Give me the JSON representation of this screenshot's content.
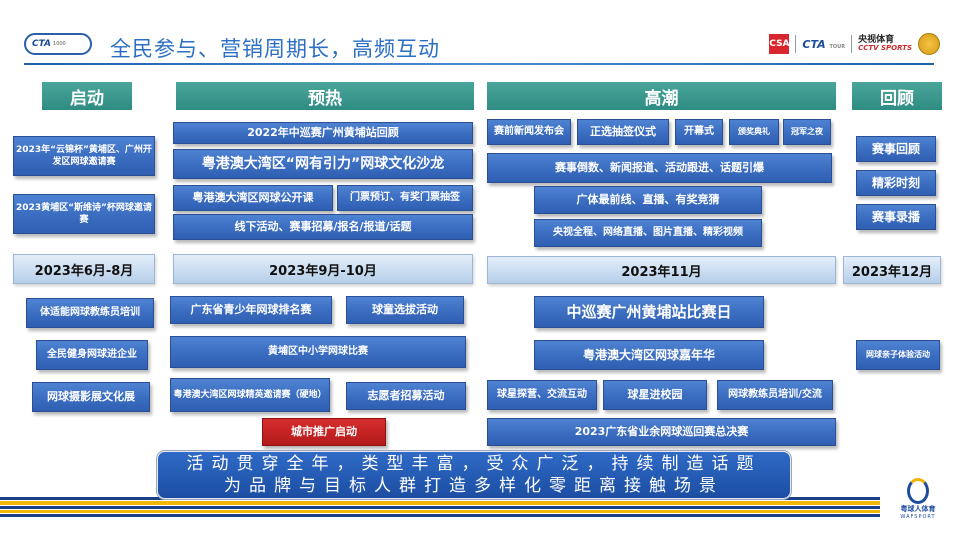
{
  "header": {
    "logo_left": "CTA",
    "logo_left_sub": "1000",
    "title": "全民参与、营销周期长，高频互动",
    "brand_csa": "CSA",
    "brand_cta": "CTA",
    "brand_cta_sub": "TOUR",
    "brand_cctv_cn": "央视体育",
    "brand_cctv_en": "CCTV SPORTS"
  },
  "phases": {
    "start": "启动",
    "warmup": "预热",
    "climax": "高潮",
    "review": "回顾"
  },
  "start": {
    "item1": "2023年“云锦杯”黄埔区、广州开发区网球邀请赛",
    "item2": "2023黄埔区“斯维诗”杯网球邀请赛",
    "date": "2023年6月-8月",
    "item3": "体适能网球教练员培训",
    "item4": "全民健身网球进企业",
    "item5": "网球摄影展文化展"
  },
  "warmup": {
    "item1": "2022年中巡赛广州黄埔站回顾",
    "item2": "粤港澳大湾区“网有引力”网球文化沙龙",
    "item3": "粤港澳大湾区网球公开课",
    "item4": "门票预订、有奖门票抽签",
    "item5": "线下活动、赛事招募/报名/报道/话题",
    "date": "2023年9月-10月",
    "item6": "广东省青少年网球排名赛",
    "item7": "球童选拔活动",
    "item8": "黄埔区中小学网球比赛",
    "item9": "粤港澳大湾区网球精英邀请赛（硬地）",
    "item10": "志愿者招募活动",
    "item11": "城市推广启动"
  },
  "climax": {
    "item1": "赛前新闻发布会",
    "item2": "正选抽签仪式",
    "item3": "开幕式",
    "item4": "颁奖典礼",
    "item5": "冠军之夜",
    "item6": "赛事倒数、新闻报道、活动跟进、话题引爆",
    "item7": "广体最前线、直播、有奖竞猜",
    "item8": "央视全程、网络直播、图片直播、精彩视频",
    "date": "2023年11月",
    "item9": "中巡赛广州黄埔站比赛日",
    "item10": "粤港澳大湾区网球嘉年华",
    "item11": "球星探营、交流互动",
    "item12": "球星进校园",
    "item13": "网球教练员培训/交流",
    "item14": "2023广东省业余网球巡回赛总决赛"
  },
  "review": {
    "item1": "赛事回顾",
    "item2": "精彩时刻",
    "item3": "赛事录播",
    "date": "2023年12月",
    "item4": "网球亲子体验活动"
  },
  "slogan": {
    "line1": "活动贯穿全年，类型丰富，受众广泛，持续制造话题",
    "line2": "为品牌与目标人群打造多样化零距离接触场景"
  },
  "footer": {
    "brand_cn": "粤球人体育",
    "brand_en": "WAFSPORT"
  },
  "colors": {
    "phase": "#3a988e",
    "box": "#3a6cc0",
    "date": "#cfe0f2",
    "highlight": "#c82323",
    "title": "#2a6fc4"
  }
}
